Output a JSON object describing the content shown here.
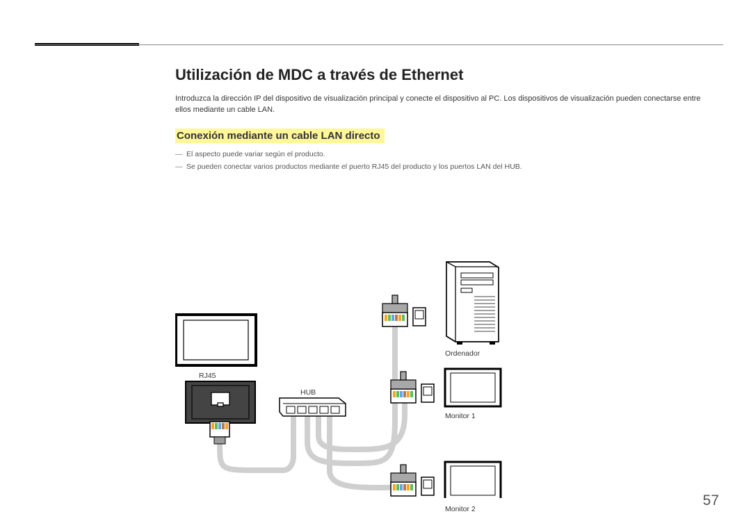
{
  "title": "Utilización de MDC a través de Ethernet",
  "intro": "Introduzca la dirección IP del dispositivo de visualización principal y conecte el dispositivo al PC. Los dispositivos de visualización pueden conectarse entre ellos mediante un cable LAN.",
  "subheading": "Conexión mediante un cable LAN directo",
  "notes": [
    "El aspecto puede variar según el producto.",
    "Se pueden conectar varios productos mediante el puerto RJ45 del producto y los puertos LAN del HUB."
  ],
  "labels": {
    "rj45": "RJ45",
    "hub": "HUB",
    "computer": "Ordenador",
    "monitor1": "Monitor 1",
    "monitor2": "Monitor 2"
  },
  "pageNumber": "57"
}
